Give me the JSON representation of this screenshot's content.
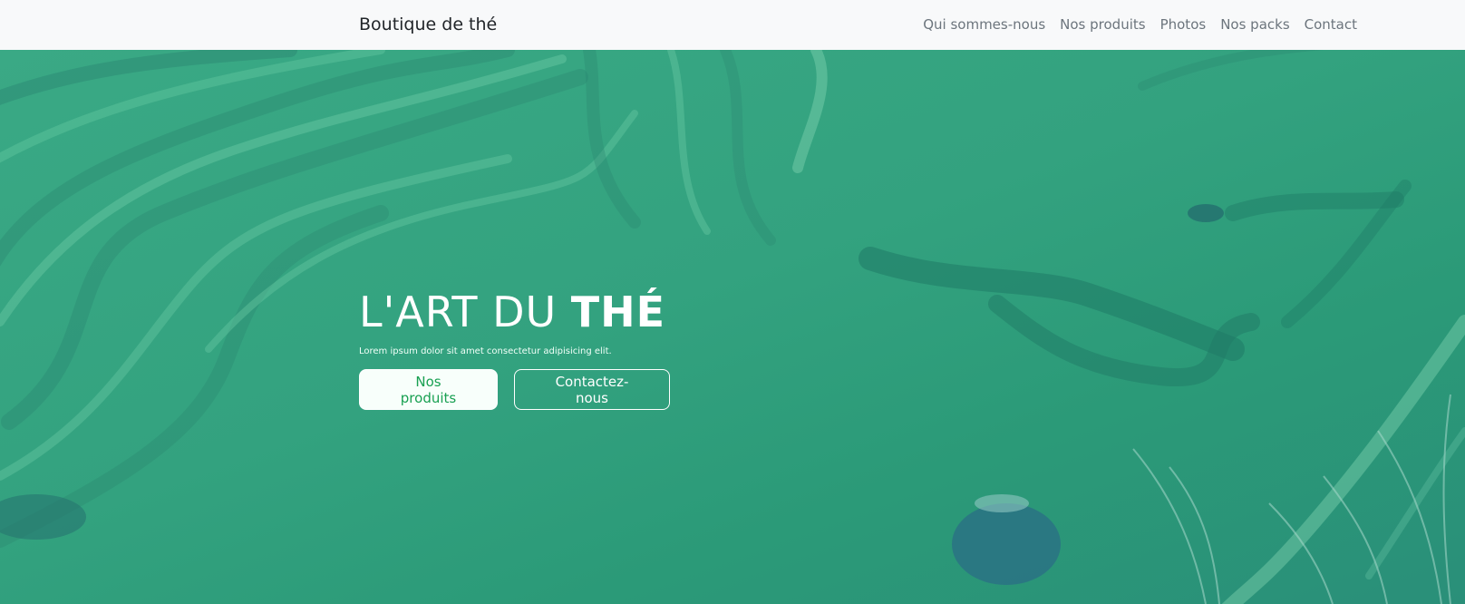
{
  "navbar": {
    "brand": "Boutique de thé",
    "links": [
      "Qui sommes-nous",
      "Nos produits",
      "Photos",
      "Nos packs",
      "Contact"
    ]
  },
  "hero": {
    "title_light": "L'ART DU",
    "title_bold": "THÉ",
    "subtitle": "Lorem ipsum dolor sit amet consectetur adipisicing elit.",
    "primary_button": "Nos produits",
    "secondary_button": "Contactez-nous"
  },
  "colors": {
    "hero_overlay": "#2f9d7b",
    "primary_button_text": "#19a052",
    "navbar_bg": "#f8f9fa"
  }
}
